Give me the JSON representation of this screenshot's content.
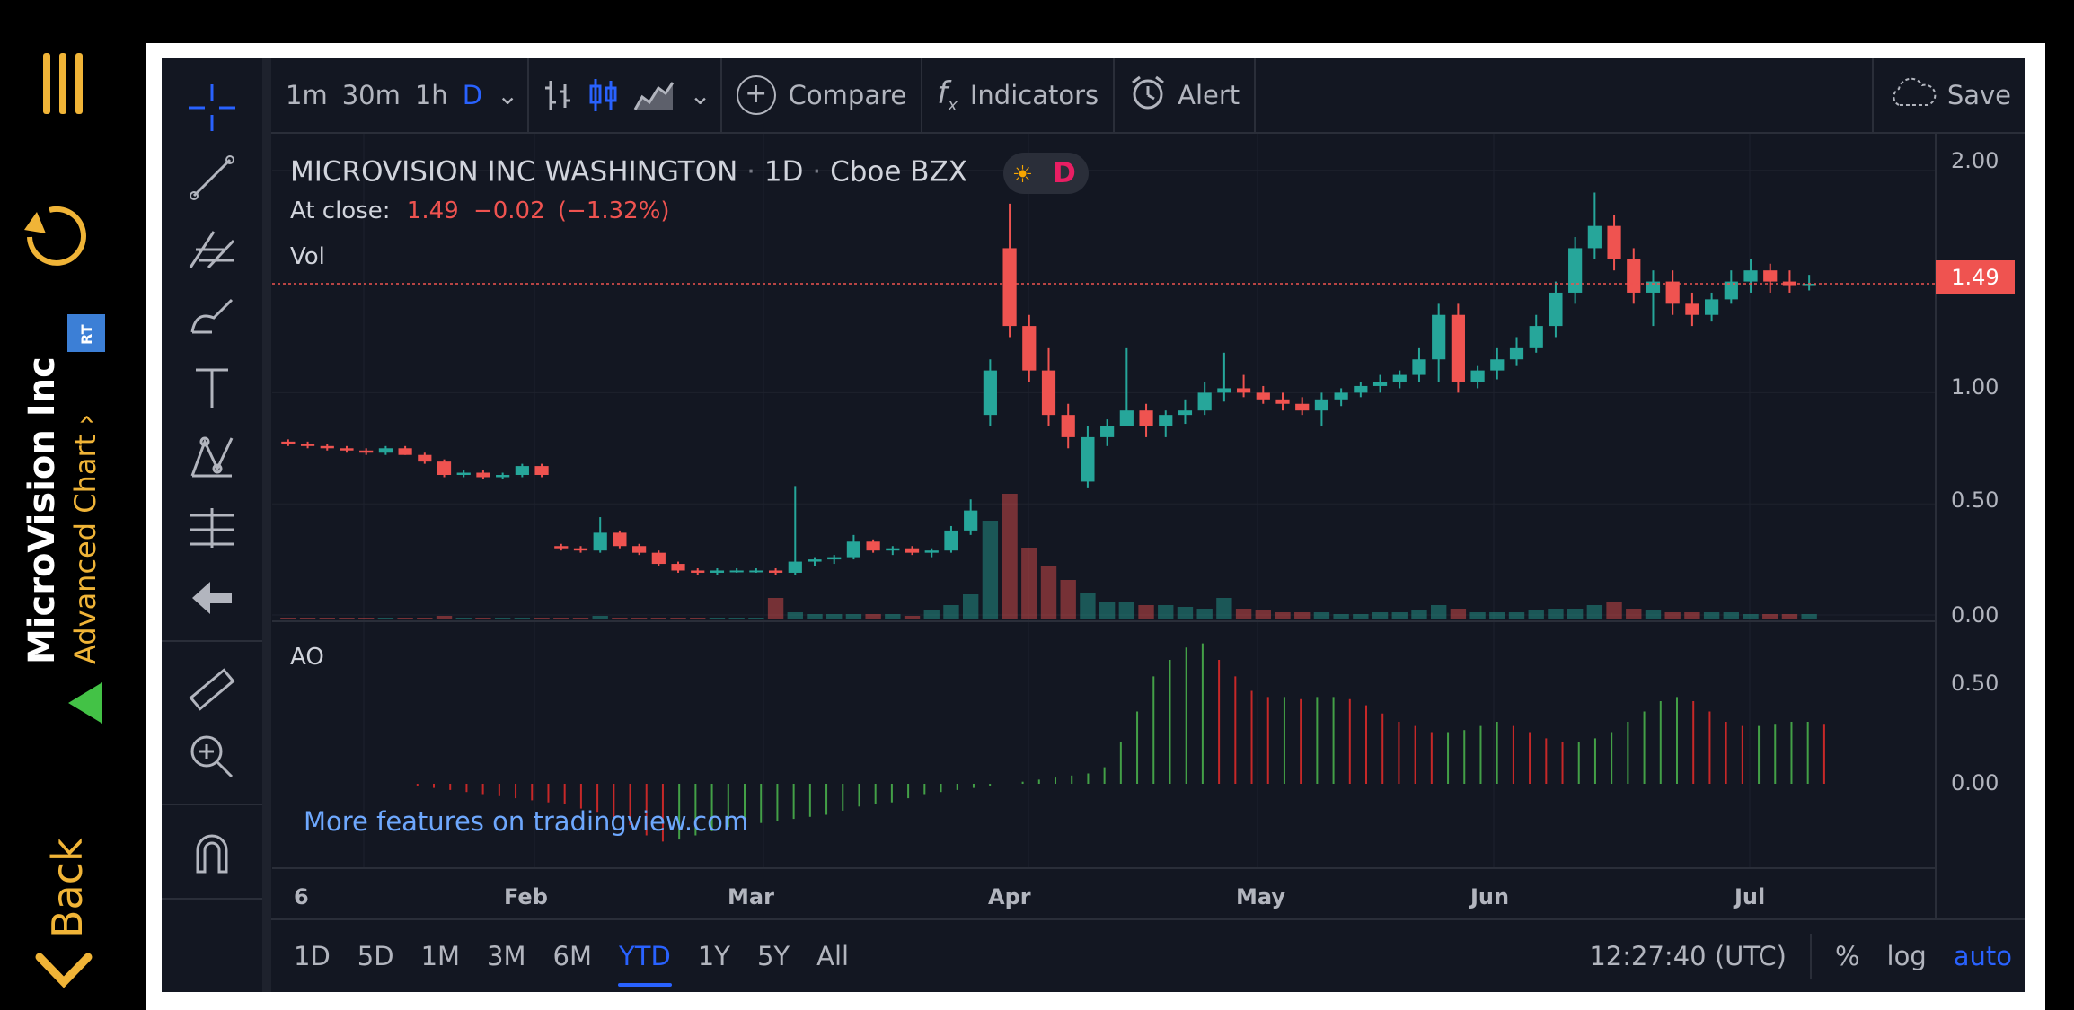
{
  "app": {
    "back_label": "Back",
    "company_name": "MicroVision Inc",
    "subtitle": "Advanced Chart",
    "rt_badge": "RT",
    "colors": {
      "accent": "#f0b437",
      "up": "#26a69a",
      "down": "#ef5350",
      "blue": "#2962ff"
    }
  },
  "toolbar": {
    "intervals": [
      "1m",
      "30m",
      "1h",
      "D"
    ],
    "active_interval": "D",
    "compare_label": "Compare",
    "indicators_label": "Indicators",
    "alert_label": "Alert",
    "save_label": "Save"
  },
  "legend": {
    "symbol": "MICROVISION INC WASHINGTON",
    "interval": "1D",
    "exchange": "Cboe BZX",
    "badge": "D",
    "close_label": "At close:",
    "close_value": "1.49",
    "change": "−0.02",
    "change_pct": "(−1.32%)",
    "vol_label": "Vol",
    "ao_label": "AO",
    "last_price_tag": "1.49"
  },
  "promo": "More features on tradingview.com",
  "price_axis": [
    "2.00",
    "1.00",
    "0.50",
    "0.00"
  ],
  "ao_axis": [
    "0.50",
    "0.00"
  ],
  "time_axis": [
    "6",
    "Feb",
    "Mar",
    "Apr",
    "May",
    "Jun",
    "Jul"
  ],
  "bottom": {
    "ranges": [
      "1D",
      "5D",
      "1M",
      "3M",
      "6M",
      "YTD",
      "1Y",
      "5Y",
      "All"
    ],
    "active_range": "YTD",
    "clock": "12:27:40 (UTC)",
    "pct": "%",
    "log": "log",
    "auto": "auto"
  },
  "chart_data": {
    "type": "candlestick",
    "ylim": [
      0,
      2.1
    ],
    "candles": [
      [
        0.78,
        0.79,
        0.76,
        0.77
      ],
      [
        0.77,
        0.78,
        0.75,
        0.76
      ],
      [
        0.76,
        0.77,
        0.74,
        0.75
      ],
      [
        0.75,
        0.76,
        0.73,
        0.74
      ],
      [
        0.74,
        0.75,
        0.72,
        0.73
      ],
      [
        0.73,
        0.76,
        0.72,
        0.75
      ],
      [
        0.75,
        0.76,
        0.72,
        0.72
      ],
      [
        0.72,
        0.73,
        0.68,
        0.69
      ],
      [
        0.69,
        0.7,
        0.62,
        0.63
      ],
      [
        0.63,
        0.65,
        0.62,
        0.64
      ],
      [
        0.64,
        0.65,
        0.61,
        0.62
      ],
      [
        0.62,
        0.64,
        0.61,
        0.63
      ],
      [
        0.63,
        0.68,
        0.62,
        0.67
      ],
      [
        0.67,
        0.68,
        0.62,
        0.63
      ],
      [
        0.31,
        0.32,
        0.29,
        0.3
      ],
      [
        0.3,
        0.31,
        0.28,
        0.29
      ],
      [
        0.29,
        0.44,
        0.28,
        0.37
      ],
      [
        0.37,
        0.38,
        0.3,
        0.31
      ],
      [
        0.31,
        0.32,
        0.27,
        0.28
      ],
      [
        0.28,
        0.29,
        0.22,
        0.23
      ],
      [
        0.23,
        0.24,
        0.19,
        0.2
      ],
      [
        0.2,
        0.21,
        0.18,
        0.19
      ],
      [
        0.19,
        0.21,
        0.18,
        0.2
      ],
      [
        0.2,
        0.21,
        0.19,
        0.2
      ],
      [
        0.2,
        0.21,
        0.19,
        0.2
      ],
      [
        0.2,
        0.21,
        0.18,
        0.19
      ],
      [
        0.19,
        0.58,
        0.18,
        0.24
      ],
      [
        0.24,
        0.26,
        0.22,
        0.25
      ],
      [
        0.25,
        0.27,
        0.23,
        0.26
      ],
      [
        0.26,
        0.36,
        0.25,
        0.33
      ],
      [
        0.33,
        0.34,
        0.28,
        0.29
      ],
      [
        0.29,
        0.31,
        0.27,
        0.3
      ],
      [
        0.3,
        0.31,
        0.27,
        0.28
      ],
      [
        0.28,
        0.3,
        0.26,
        0.29
      ],
      [
        0.29,
        0.4,
        0.28,
        0.38
      ],
      [
        0.38,
        0.52,
        0.36,
        0.47
      ],
      [
        0.9,
        1.15,
        0.85,
        1.1
      ],
      [
        1.65,
        1.85,
        1.25,
        1.3
      ],
      [
        1.3,
        1.35,
        1.05,
        1.1
      ],
      [
        1.1,
        1.2,
        0.85,
        0.9
      ],
      [
        0.9,
        0.95,
        0.75,
        0.8
      ],
      [
        0.6,
        0.85,
        0.57,
        0.8
      ],
      [
        0.8,
        0.88,
        0.76,
        0.85
      ],
      [
        0.85,
        1.2,
        0.88,
        0.92
      ],
      [
        0.92,
        0.95,
        0.8,
        0.85
      ],
      [
        0.85,
        0.92,
        0.8,
        0.9
      ],
      [
        0.9,
        0.97,
        0.86,
        0.92
      ],
      [
        0.92,
        1.05,
        0.9,
        1.0
      ],
      [
        1.0,
        1.18,
        0.96,
        1.02
      ],
      [
        1.02,
        1.08,
        0.98,
        1.0
      ],
      [
        1.0,
        1.03,
        0.95,
        0.97
      ],
      [
        0.97,
        1.0,
        0.92,
        0.95
      ],
      [
        0.95,
        0.98,
        0.9,
        0.92
      ],
      [
        0.92,
        1.0,
        0.85,
        0.97
      ],
      [
        0.97,
        1.02,
        0.94,
        1.0
      ],
      [
        1.0,
        1.05,
        0.98,
        1.03
      ],
      [
        1.03,
        1.08,
        1.0,
        1.05
      ],
      [
        1.05,
        1.1,
        1.02,
        1.08
      ],
      [
        1.08,
        1.2,
        1.05,
        1.15
      ],
      [
        1.15,
        1.4,
        1.05,
        1.35
      ],
      [
        1.35,
        1.4,
        1.0,
        1.05
      ],
      [
        1.05,
        1.12,
        1.02,
        1.1
      ],
      [
        1.1,
        1.2,
        1.06,
        1.15
      ],
      [
        1.15,
        1.25,
        1.12,
        1.2
      ],
      [
        1.2,
        1.35,
        1.18,
        1.3
      ],
      [
        1.3,
        1.5,
        1.25,
        1.45
      ],
      [
        1.45,
        1.7,
        1.4,
        1.65
      ],
      [
        1.65,
        1.9,
        1.6,
        1.75
      ],
      [
        1.75,
        1.8,
        1.55,
        1.6
      ],
      [
        1.6,
        1.65,
        1.4,
        1.45
      ],
      [
        1.45,
        1.55,
        1.3,
        1.5
      ],
      [
        1.5,
        1.55,
        1.35,
        1.4
      ],
      [
        1.4,
        1.45,
        1.3,
        1.35
      ],
      [
        1.35,
        1.45,
        1.32,
        1.42
      ],
      [
        1.42,
        1.55,
        1.4,
        1.5
      ],
      [
        1.5,
        1.6,
        1.45,
        1.55
      ],
      [
        1.55,
        1.58,
        1.45,
        1.5
      ],
      [
        1.5,
        1.55,
        1.45,
        1.48
      ],
      [
        1.48,
        1.53,
        1.46,
        1.49
      ]
    ],
    "volume": [
      1,
      1,
      1,
      1,
      1,
      1,
      1,
      1,
      2,
      1,
      1,
      1,
      1,
      1,
      1,
      1,
      2,
      1,
      1,
      1,
      1,
      1,
      1,
      1,
      1,
      12,
      4,
      3,
      3,
      3,
      3,
      3,
      2,
      5,
      8,
      14,
      55,
      70,
      40,
      30,
      22,
      15,
      10,
      10,
      8,
      8,
      7,
      6,
      12,
      6,
      5,
      4,
      4,
      4,
      3,
      3,
      4,
      4,
      5,
      8,
      6,
      4,
      4,
      4,
      5,
      6,
      6,
      8,
      10,
      6,
      5,
      4,
      4,
      4,
      4,
      3,
      3,
      3,
      3
    ],
    "ao": [
      0,
      0,
      0,
      0,
      0,
      0,
      0,
      0,
      -0.01,
      -0.02,
      -0.03,
      -0.04,
      -0.05,
      -0.06,
      -0.07,
      -0.08,
      -0.09,
      -0.1,
      -0.12,
      -0.14,
      -0.16,
      -0.2,
      -0.25,
      -0.28,
      -0.27,
      -0.25,
      -0.23,
      -0.21,
      -0.2,
      -0.19,
      -0.18,
      -0.17,
      -0.16,
      -0.15,
      -0.13,
      -0.11,
      -0.1,
      -0.09,
      -0.07,
      -0.05,
      -0.04,
      -0.03,
      -0.02,
      -0.01,
      0,
      0.01,
      0.02,
      0.03,
      0.04,
      0.05,
      0.08,
      0.2,
      0.35,
      0.52,
      0.6,
      0.66,
      0.68,
      0.6,
      0.52,
      0.45,
      0.42,
      0.42,
      0.41,
      0.42,
      0.42,
      0.41,
      0.38,
      0.34,
      0.3,
      0.28,
      0.25,
      0.25,
      0.26,
      0.28,
      0.3,
      0.28,
      0.25,
      0.22,
      0.2,
      0.2,
      0.22,
      0.25,
      0.3,
      0.35,
      0.4,
      0.42,
      0.4,
      0.35,
      0.3,
      0.28,
      0.28,
      0.29,
      0.3,
      0.3,
      0.29
    ]
  }
}
